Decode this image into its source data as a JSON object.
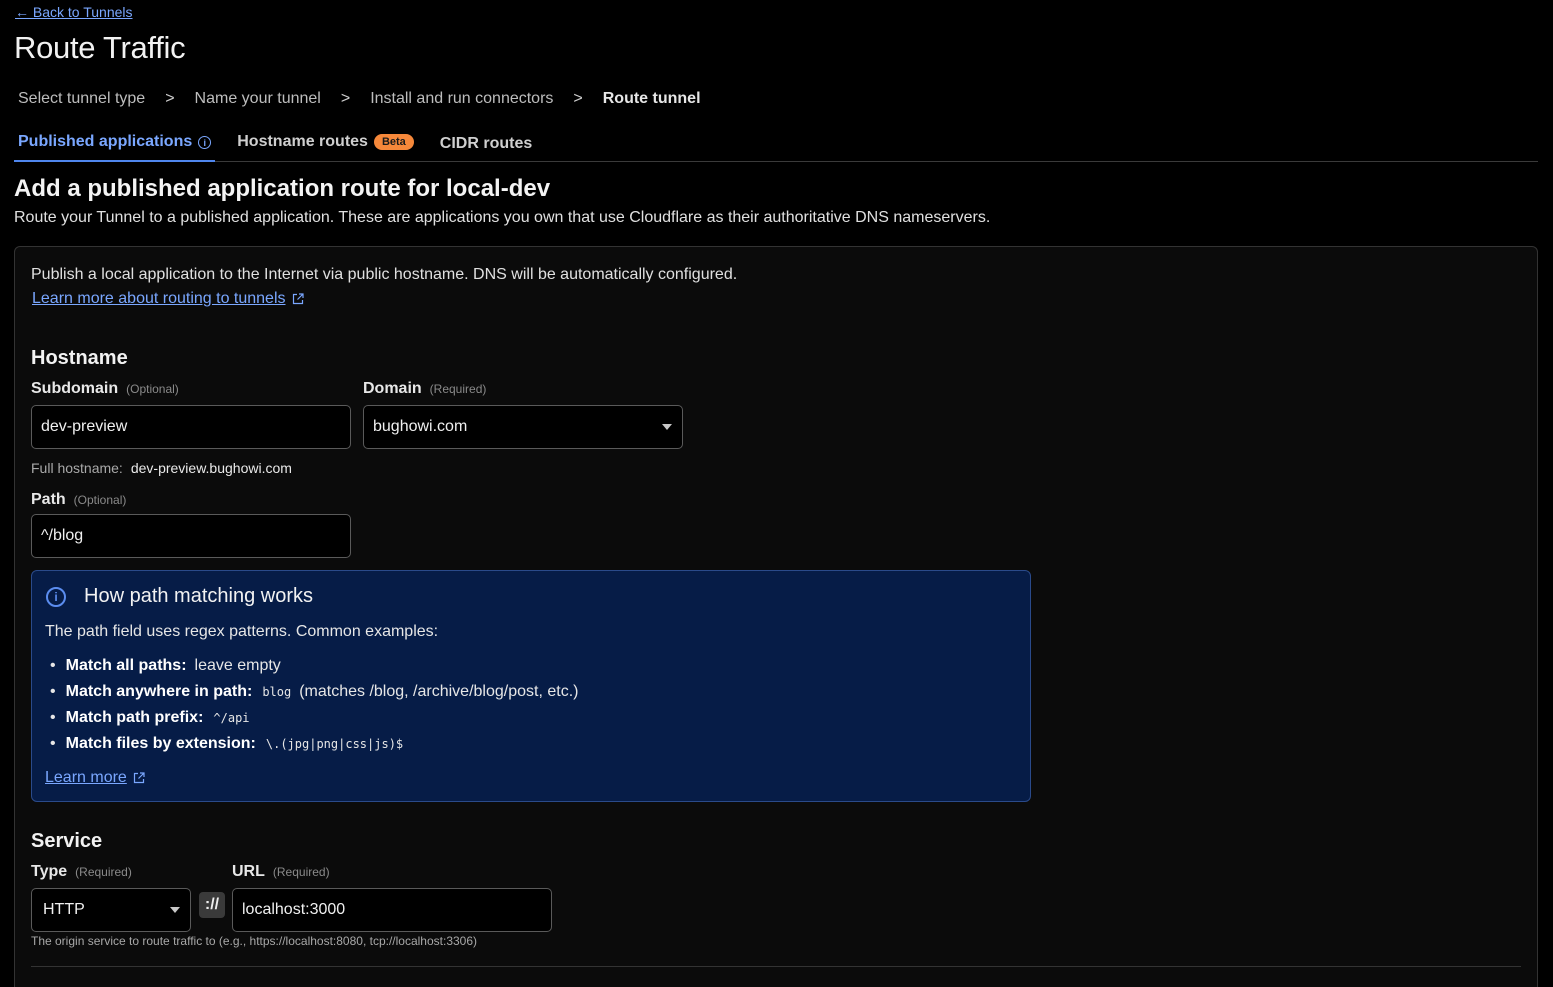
{
  "nav": {
    "back_label": "← Back to Tunnels"
  },
  "page": {
    "title": "Route Traffic"
  },
  "steps": {
    "items": [
      "Select tunnel type",
      "Name your tunnel",
      "Install and run connectors",
      "Route tunnel"
    ],
    "separator": ">"
  },
  "tabs": {
    "published": "Published applications",
    "hostname": "Hostname routes",
    "hostname_badge": "Beta",
    "cidr": "CIDR routes"
  },
  "section": {
    "title": "Add a published application route for local-dev",
    "description": "Route your Tunnel to a published application. These are applications you own that use Cloudflare as their authoritative DNS nameservers."
  },
  "card": {
    "intro": "Publish a local application to the Internet via public hostname. DNS will be automatically configured.",
    "learn_more": "Learn more about routing to tunnels"
  },
  "hostname": {
    "heading": "Hostname",
    "subdomain_label": "Subdomain",
    "subdomain_hint": "(Optional)",
    "subdomain_value": "dev-preview",
    "domain_label": "Domain",
    "domain_hint": "(Required)",
    "domain_value": "bughowi.com",
    "full_hostname_label": "Full hostname:",
    "full_hostname_value": "dev-preview.bughowi.com",
    "path_label": "Path",
    "path_hint": "(Optional)",
    "path_value": "^/blog"
  },
  "path_info": {
    "title": "How path matching works",
    "intro": "The path field uses regex patterns. Common examples:",
    "items": [
      {
        "label": "Match all paths:",
        "text": "leave empty",
        "code": ""
      },
      {
        "label": "Match anywhere in path:",
        "code": "blog",
        "text": "(matches /blog, /archive/blog/post, etc.)"
      },
      {
        "label": "Match path prefix:",
        "code": "^/api",
        "text": ""
      },
      {
        "label": "Match files by extension:",
        "code": "\\.(jpg|png|css|js)$",
        "text": ""
      }
    ],
    "learn_more": "Learn more"
  },
  "service": {
    "heading": "Service",
    "type_label": "Type",
    "type_hint": "(Required)",
    "type_value": "HTTP",
    "protocol_sep": "://",
    "url_label": "URL",
    "url_hint": "(Required)",
    "url_value": "localhost:3000",
    "help": "The origin service to route traffic to (e.g., https://localhost:8080, tcp://localhost:3306)"
  },
  "colors": {
    "link": "#7aa7ff",
    "beta_badge": "#f6883a",
    "info_bg": "#061c47"
  }
}
